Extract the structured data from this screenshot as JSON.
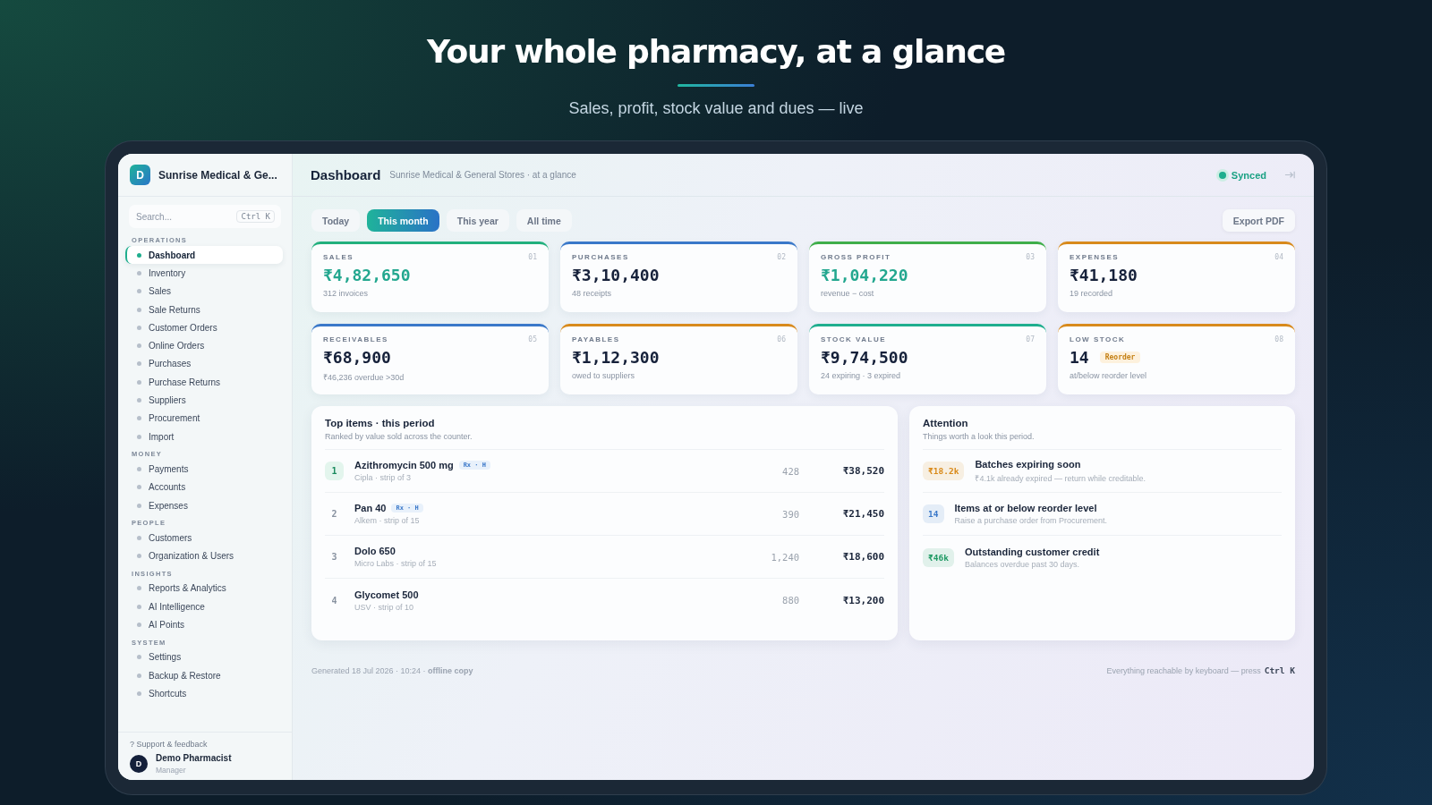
{
  "hero": {
    "title": "Your whole pharmacy, at a glance",
    "subtitle": "Sales, profit, stock value and dues — live"
  },
  "sidebar": {
    "brand_initial": "D",
    "brand_name": "Sunrise Medical & Ge...",
    "search": {
      "placeholder": "Search...",
      "shortcut": "Ctrl K"
    },
    "sections": [
      {
        "title": "OPERATIONS",
        "items": [
          {
            "label": "Dashboard",
            "selected": true
          },
          {
            "label": "Inventory",
            "selected": false
          },
          {
            "label": "Sales",
            "selected": false
          },
          {
            "label": "Sale Returns",
            "selected": false
          },
          {
            "label": "Customer Orders",
            "selected": false
          },
          {
            "label": "Online Orders",
            "selected": false
          },
          {
            "label": "Purchases",
            "selected": false
          },
          {
            "label": "Purchase Returns",
            "selected": false
          },
          {
            "label": "Suppliers",
            "selected": false
          },
          {
            "label": "Procurement",
            "selected": false
          },
          {
            "label": "Import",
            "selected": false
          }
        ]
      },
      {
        "title": "MONEY",
        "items": [
          {
            "label": "Payments",
            "selected": false
          },
          {
            "label": "Accounts",
            "selected": false
          },
          {
            "label": "Expenses",
            "selected": false
          }
        ]
      },
      {
        "title": "PEOPLE",
        "items": [
          {
            "label": "Customers",
            "selected": false
          },
          {
            "label": "Organization & Users",
            "selected": false
          }
        ]
      },
      {
        "title": "INSIGHTS",
        "items": [
          {
            "label": "Reports & Analytics",
            "selected": false
          },
          {
            "label": "AI Intelligence",
            "selected": false
          },
          {
            "label": "AI Points",
            "selected": false
          }
        ]
      },
      {
        "title": "SYSTEM",
        "items": [
          {
            "label": "Settings",
            "selected": false
          },
          {
            "label": "Backup & Restore",
            "selected": false
          },
          {
            "label": "Shortcuts",
            "selected": false
          }
        ]
      }
    ],
    "support": "? Support & feedback",
    "user": {
      "initial": "D",
      "name": "Demo Pharmacist",
      "role": "Manager"
    }
  },
  "header": {
    "title": "Dashboard",
    "subtitle": "Sunrise Medical & General Stores · at a glance",
    "status": "Synced"
  },
  "tabs": [
    {
      "label": "Today",
      "selected": false
    },
    {
      "label": "This month",
      "selected": true
    },
    {
      "label": "This year",
      "selected": false
    },
    {
      "label": "All time",
      "selected": false
    }
  ],
  "export_button": "Export PDF",
  "cards": [
    {
      "label": "SALES",
      "number": "01",
      "value": "₹4,82,650",
      "sub": "312 invoices",
      "color": "#22b07d",
      "highlight": true
    },
    {
      "label": "PURCHASES",
      "number": "02",
      "value": "₹3,10,400",
      "sub": "48 receipts",
      "color": "#3a78c9",
      "highlight": false
    },
    {
      "label": "GROSS PROFIT",
      "number": "03",
      "value": "₹1,04,220",
      "sub": "revenue − cost",
      "color": "#3fae4a",
      "highlight": true
    },
    {
      "label": "EXPENSES",
      "number": "04",
      "value": "₹41,180",
      "sub": "19 recorded",
      "color": "#d88a1c",
      "highlight": false
    },
    {
      "label": "RECEIVABLES",
      "number": "05",
      "value": "₹68,900",
      "sub": "₹46,236 overdue >30d",
      "color": "#3a78c9",
      "highlight": false
    },
    {
      "label": "PAYABLES",
      "number": "06",
      "value": "₹1,12,300",
      "sub": "owed to suppliers",
      "color": "#d88a1c",
      "highlight": false
    },
    {
      "label": "STOCK VALUE",
      "number": "07",
      "value": "₹9,74,500",
      "sub": "24 expiring · 3 expired",
      "color": "#1fae8e",
      "highlight": false
    },
    {
      "label": "LOW STOCK",
      "number": "08",
      "value": "14",
      "badge": "Reorder",
      "sub": "at/below reorder level",
      "color": "#d88a1c",
      "highlight": false
    }
  ],
  "top_items": {
    "title": "Top items · this period",
    "subtitle": "Ranked by value sold across the counter.",
    "rows": [
      {
        "rank": "1",
        "selected": true,
        "name": "Azithromycin 500 mg",
        "tag": "Rx · H",
        "sub": "Cipla · strip of 3",
        "qty": "428",
        "amount": "₹38,520"
      },
      {
        "rank": "2",
        "selected": false,
        "name": "Pan 40",
        "tag": "Rx · H",
        "sub": "Alkem · strip of 15",
        "qty": "390",
        "amount": "₹21,450"
      },
      {
        "rank": "3",
        "selected": false,
        "name": "Dolo 650",
        "sub": "Micro Labs · strip of 15",
        "qty": "1,240",
        "amount": "₹18,600"
      },
      {
        "rank": "4",
        "selected": false,
        "name": "Glycomet 500",
        "sub": "USV · strip of 10",
        "qty": "880",
        "amount": "₹13,200"
      }
    ]
  },
  "attention": {
    "title": "Attention",
    "subtitle": "Things worth a look this period.",
    "items": [
      {
        "badge": "₹18.2k",
        "color": "#d98a1a",
        "title": "Batches expiring soon",
        "sub": "₹4.1k already expired — return while creditable."
      },
      {
        "badge": "14",
        "color": "#3a78c9",
        "title": "Items at or below reorder level",
        "sub": "Raise a purchase order from Procurement."
      },
      {
        "badge": "₹46k",
        "color": "#1f9a64",
        "title": "Outstanding customer credit",
        "sub": "Balances overdue past 30 days."
      }
    ]
  },
  "footer": {
    "generated": "Generated 18 Jul 2026 · 10:24 · **offline copy**",
    "hint": "Everything reachable by keyboard — press",
    "shortcut": "Ctrl K"
  }
}
